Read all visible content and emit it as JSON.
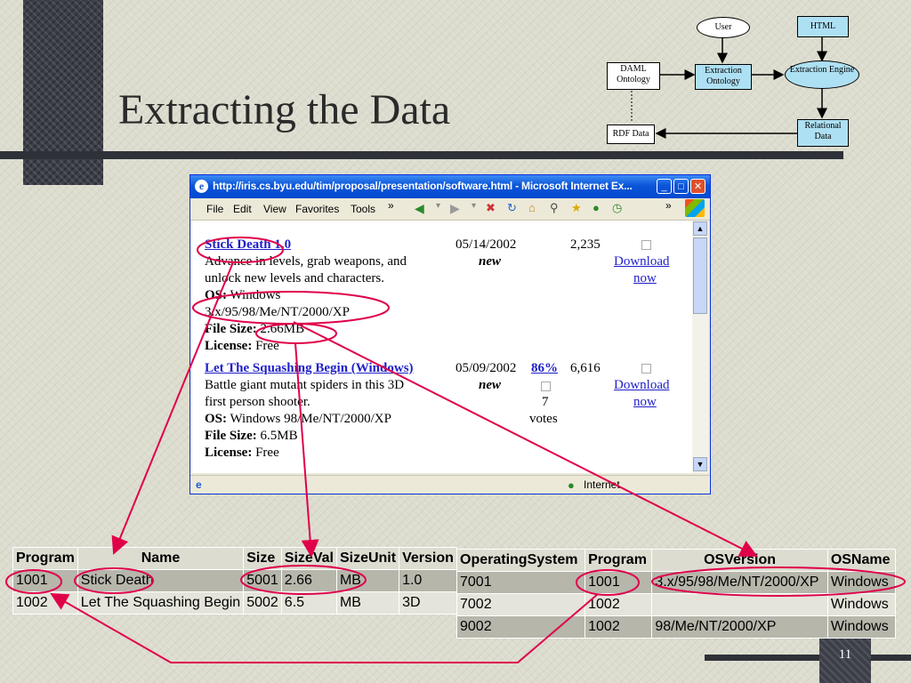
{
  "slide": {
    "title": "Extracting the Data",
    "page_number": "11"
  },
  "diagram": {
    "user": "User",
    "html": "HTML",
    "daml_ontology": "DAML Ontology",
    "extraction_ontology": "Extraction Ontology",
    "extraction_engine": "Extraction Engine",
    "rdf_data": "RDF Data",
    "relational_data": "Relational Data"
  },
  "browser": {
    "title": "http://iris.cs.byu.edu/tim/proposal/presentation/software.html - Microsoft Internet Ex...",
    "menu": [
      "File",
      "Edit",
      "View",
      "Favorites",
      "Tools"
    ],
    "status_zone": "Internet",
    "entries": [
      {
        "name": "Stick Death 1.0",
        "desc_line1": "Advance in levels, grab weapons, and",
        "desc_line2": "unlock new levels and characters.",
        "os_label": "OS:",
        "os_value": "Windows",
        "os_line2": "3.x/95/98/Me/NT/2000/XP",
        "size_label": "File Size:",
        "size_value": "2.66MB",
        "license_label": "License:",
        "license_value": "Free",
        "date": "05/14/2002",
        "badge": "new",
        "downloads": "2,235",
        "download_line1": "Download",
        "download_line2": "now"
      },
      {
        "name": "Let The Squashing Begin (Windows)",
        "desc_line1": "Battle giant mutant spiders in this 3D",
        "desc_line2": "first person shooter.",
        "os_label": "OS:",
        "os_value": "Windows 98/Me/NT/2000/XP",
        "size_label": "File Size:",
        "size_value": "6.5MB",
        "license_label": "License:",
        "license_value": "Free",
        "date": "05/09/2002",
        "badge": "new",
        "rating": "86%",
        "votes_count": "7",
        "votes_label": "votes",
        "downloads": "6,616",
        "download_line1": "Download",
        "download_line2": "now"
      }
    ]
  },
  "program_table": {
    "headers": [
      "Program",
      "Name",
      "Size",
      "SizeVal",
      "SizeUnit",
      "Version"
    ],
    "rows": [
      [
        "1001",
        "Stick Death",
        "5001",
        "2.66",
        "MB",
        "1.0"
      ],
      [
        "1002",
        "Let The Squashing Begin",
        "5002",
        "6.5",
        "MB",
        "3D"
      ]
    ]
  },
  "os_table": {
    "headers": [
      "OperatingSystem",
      "Program",
      "OSVersion",
      "OSName"
    ],
    "rows": [
      [
        "7001",
        "1001",
        "3.x/95/98/Me/NT/2000/XP",
        "Windows"
      ],
      [
        "7002",
        "1002",
        "",
        "Windows"
      ],
      [
        "9002",
        "1002",
        "98/Me/NT/2000/XP",
        "Windows"
      ]
    ]
  },
  "colors": {
    "annotation": "#e0004a",
    "table_header": "#dcdcd0",
    "dark_bar": "#2f3138"
  }
}
